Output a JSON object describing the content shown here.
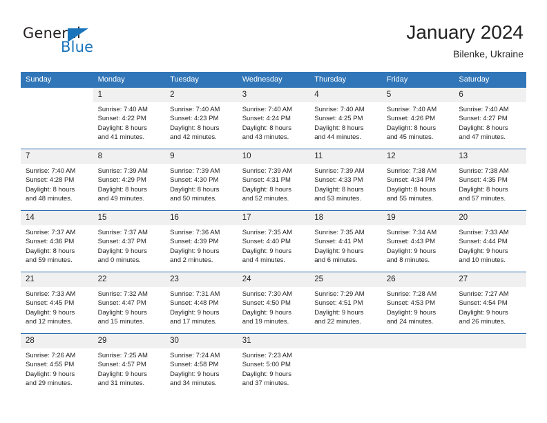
{
  "brand": {
    "word_one": "General",
    "word_two": "Blue",
    "accent_color": "#1a74bb"
  },
  "header": {
    "title": "January 2024",
    "location": "Bilenke, Ukraine"
  },
  "theme": {
    "header_blue": "#3176b8",
    "separator_blue": "#2a6cb0",
    "date_band_gray": "#f0f0f0"
  },
  "weekday_headers": [
    "Sunday",
    "Monday",
    "Tuesday",
    "Wednesday",
    "Thursday",
    "Friday",
    "Saturday"
  ],
  "weeks": [
    [
      {
        "day": "",
        "lines": []
      },
      {
        "day": "1",
        "lines": [
          "Sunrise: 7:40 AM",
          "Sunset: 4:22 PM",
          "Daylight: 8 hours",
          "and 41 minutes."
        ]
      },
      {
        "day": "2",
        "lines": [
          "Sunrise: 7:40 AM",
          "Sunset: 4:23 PM",
          "Daylight: 8 hours",
          "and 42 minutes."
        ]
      },
      {
        "day": "3",
        "lines": [
          "Sunrise: 7:40 AM",
          "Sunset: 4:24 PM",
          "Daylight: 8 hours",
          "and 43 minutes."
        ]
      },
      {
        "day": "4",
        "lines": [
          "Sunrise: 7:40 AM",
          "Sunset: 4:25 PM",
          "Daylight: 8 hours",
          "and 44 minutes."
        ]
      },
      {
        "day": "5",
        "lines": [
          "Sunrise: 7:40 AM",
          "Sunset: 4:26 PM",
          "Daylight: 8 hours",
          "and 45 minutes."
        ]
      },
      {
        "day": "6",
        "lines": [
          "Sunrise: 7:40 AM",
          "Sunset: 4:27 PM",
          "Daylight: 8 hours",
          "and 47 minutes."
        ]
      }
    ],
    [
      {
        "day": "7",
        "lines": [
          "Sunrise: 7:40 AM",
          "Sunset: 4:28 PM",
          "Daylight: 8 hours",
          "and 48 minutes."
        ]
      },
      {
        "day": "8",
        "lines": [
          "Sunrise: 7:39 AM",
          "Sunset: 4:29 PM",
          "Daylight: 8 hours",
          "and 49 minutes."
        ]
      },
      {
        "day": "9",
        "lines": [
          "Sunrise: 7:39 AM",
          "Sunset: 4:30 PM",
          "Daylight: 8 hours",
          "and 50 minutes."
        ]
      },
      {
        "day": "10",
        "lines": [
          "Sunrise: 7:39 AM",
          "Sunset: 4:31 PM",
          "Daylight: 8 hours",
          "and 52 minutes."
        ]
      },
      {
        "day": "11",
        "lines": [
          "Sunrise: 7:39 AM",
          "Sunset: 4:33 PM",
          "Daylight: 8 hours",
          "and 53 minutes."
        ]
      },
      {
        "day": "12",
        "lines": [
          "Sunrise: 7:38 AM",
          "Sunset: 4:34 PM",
          "Daylight: 8 hours",
          "and 55 minutes."
        ]
      },
      {
        "day": "13",
        "lines": [
          "Sunrise: 7:38 AM",
          "Sunset: 4:35 PM",
          "Daylight: 8 hours",
          "and 57 minutes."
        ]
      }
    ],
    [
      {
        "day": "14",
        "lines": [
          "Sunrise: 7:37 AM",
          "Sunset: 4:36 PM",
          "Daylight: 8 hours",
          "and 59 minutes."
        ]
      },
      {
        "day": "15",
        "lines": [
          "Sunrise: 7:37 AM",
          "Sunset: 4:37 PM",
          "Daylight: 9 hours",
          "and 0 minutes."
        ]
      },
      {
        "day": "16",
        "lines": [
          "Sunrise: 7:36 AM",
          "Sunset: 4:39 PM",
          "Daylight: 9 hours",
          "and 2 minutes."
        ]
      },
      {
        "day": "17",
        "lines": [
          "Sunrise: 7:35 AM",
          "Sunset: 4:40 PM",
          "Daylight: 9 hours",
          "and 4 minutes."
        ]
      },
      {
        "day": "18",
        "lines": [
          "Sunrise: 7:35 AM",
          "Sunset: 4:41 PM",
          "Daylight: 9 hours",
          "and 6 minutes."
        ]
      },
      {
        "day": "19",
        "lines": [
          "Sunrise: 7:34 AM",
          "Sunset: 4:43 PM",
          "Daylight: 9 hours",
          "and 8 minutes."
        ]
      },
      {
        "day": "20",
        "lines": [
          "Sunrise: 7:33 AM",
          "Sunset: 4:44 PM",
          "Daylight: 9 hours",
          "and 10 minutes."
        ]
      }
    ],
    [
      {
        "day": "21",
        "lines": [
          "Sunrise: 7:33 AM",
          "Sunset: 4:45 PM",
          "Daylight: 9 hours",
          "and 12 minutes."
        ]
      },
      {
        "day": "22",
        "lines": [
          "Sunrise: 7:32 AM",
          "Sunset: 4:47 PM",
          "Daylight: 9 hours",
          "and 15 minutes."
        ]
      },
      {
        "day": "23",
        "lines": [
          "Sunrise: 7:31 AM",
          "Sunset: 4:48 PM",
          "Daylight: 9 hours",
          "and 17 minutes."
        ]
      },
      {
        "day": "24",
        "lines": [
          "Sunrise: 7:30 AM",
          "Sunset: 4:50 PM",
          "Daylight: 9 hours",
          "and 19 minutes."
        ]
      },
      {
        "day": "25",
        "lines": [
          "Sunrise: 7:29 AM",
          "Sunset: 4:51 PM",
          "Daylight: 9 hours",
          "and 22 minutes."
        ]
      },
      {
        "day": "26",
        "lines": [
          "Sunrise: 7:28 AM",
          "Sunset: 4:53 PM",
          "Daylight: 9 hours",
          "and 24 minutes."
        ]
      },
      {
        "day": "27",
        "lines": [
          "Sunrise: 7:27 AM",
          "Sunset: 4:54 PM",
          "Daylight: 9 hours",
          "and 26 minutes."
        ]
      }
    ],
    [
      {
        "day": "28",
        "lines": [
          "Sunrise: 7:26 AM",
          "Sunset: 4:55 PM",
          "Daylight: 9 hours",
          "and 29 minutes."
        ]
      },
      {
        "day": "29",
        "lines": [
          "Sunrise: 7:25 AM",
          "Sunset: 4:57 PM",
          "Daylight: 9 hours",
          "and 31 minutes."
        ]
      },
      {
        "day": "30",
        "lines": [
          "Sunrise: 7:24 AM",
          "Sunset: 4:58 PM",
          "Daylight: 9 hours",
          "and 34 minutes."
        ]
      },
      {
        "day": "31",
        "lines": [
          "Sunrise: 7:23 AM",
          "Sunset: 5:00 PM",
          "Daylight: 9 hours",
          "and 37 minutes."
        ]
      },
      {
        "day": "",
        "lines": []
      },
      {
        "day": "",
        "lines": []
      },
      {
        "day": "",
        "lines": []
      }
    ]
  ]
}
